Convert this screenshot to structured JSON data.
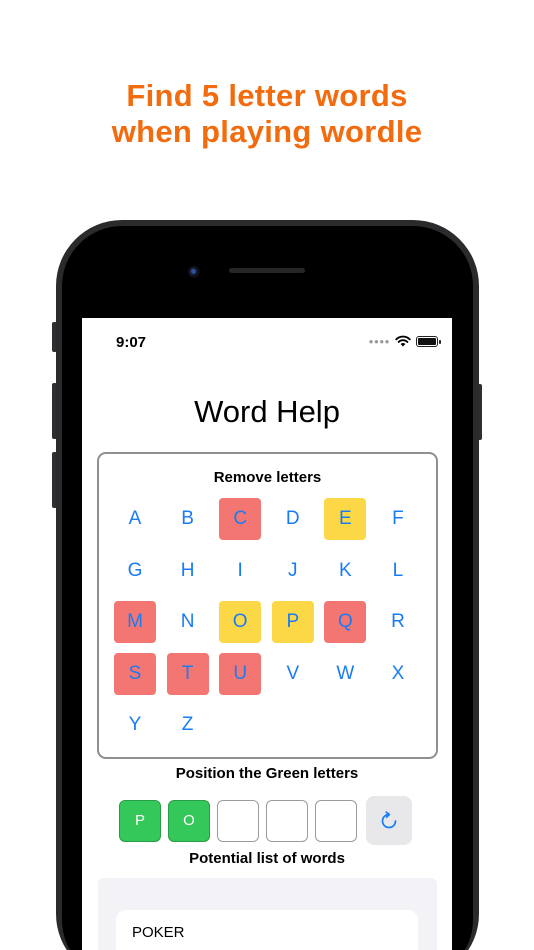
{
  "promo": {
    "line1": "Find 5 letter words",
    "line2": "when playing wordle",
    "color": "#f26b0f"
  },
  "status_bar": {
    "time": "9:07"
  },
  "app": {
    "title": "Word Help"
  },
  "remove_letters": {
    "label": "Remove letters",
    "letters": [
      {
        "letter": "A",
        "state": "default"
      },
      {
        "letter": "B",
        "state": "default"
      },
      {
        "letter": "C",
        "state": "removed"
      },
      {
        "letter": "D",
        "state": "default"
      },
      {
        "letter": "E",
        "state": "yellow"
      },
      {
        "letter": "F",
        "state": "default"
      },
      {
        "letter": "G",
        "state": "default"
      },
      {
        "letter": "H",
        "state": "default"
      },
      {
        "letter": "I",
        "state": "default"
      },
      {
        "letter": "J",
        "state": "default"
      },
      {
        "letter": "K",
        "state": "default"
      },
      {
        "letter": "L",
        "state": "default"
      },
      {
        "letter": "M",
        "state": "removed"
      },
      {
        "letter": "N",
        "state": "default"
      },
      {
        "letter": "O",
        "state": "yellow"
      },
      {
        "letter": "P",
        "state": "yellow"
      },
      {
        "letter": "Q",
        "state": "removed"
      },
      {
        "letter": "R",
        "state": "default"
      },
      {
        "letter": "S",
        "state": "removed"
      },
      {
        "letter": "T",
        "state": "removed"
      },
      {
        "letter": "U",
        "state": "removed"
      },
      {
        "letter": "V",
        "state": "default"
      },
      {
        "letter": "W",
        "state": "default"
      },
      {
        "letter": "X",
        "state": "default"
      },
      {
        "letter": "Y",
        "state": "default"
      },
      {
        "letter": "Z",
        "state": "default"
      }
    ]
  },
  "green_letters": {
    "label": "Position the Green letters",
    "slots": [
      "P",
      "O",
      "",
      "",
      ""
    ],
    "reset_icon": "refresh-icon"
  },
  "word_list": {
    "label": "Potential list of words",
    "words": [
      "POKER"
    ]
  },
  "colors": {
    "letter_blue": "#1a7cf5",
    "removed_red": "#f37672",
    "yellow": "#fcd846",
    "green": "#34c759"
  }
}
